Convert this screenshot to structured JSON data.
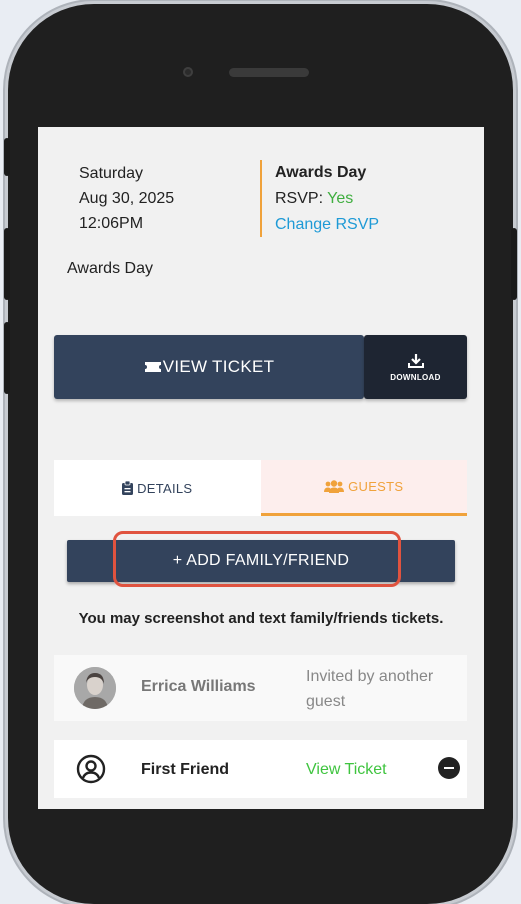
{
  "event": {
    "day": "Saturday",
    "date": "Aug 30, 2025",
    "time": "12:06PM",
    "title": "Awards Day",
    "rsvp_label": "RSVP:",
    "rsvp_value": "Yes",
    "change_rsvp": "Change RSVP",
    "name": "Awards Day"
  },
  "actions": {
    "view_ticket": "VIEW TICKET",
    "download": "DOWNLOAD"
  },
  "tabs": [
    {
      "label": "DETAILS",
      "icon": "clipboard-icon",
      "active": false
    },
    {
      "label": "GUESTS",
      "icon": "users-icon",
      "active": true
    }
  ],
  "guests": {
    "add_button": "+ ADD FAMILY/FRIEND",
    "note": "You may screenshot and text family/friends tickets.",
    "invited_guest": {
      "name": "Errica Williams",
      "status": "Invited by another guest"
    },
    "friend": {
      "name": "First Friend",
      "link": "View Ticket"
    }
  },
  "colors": {
    "primary": "#33435c",
    "accent": "#f0a23b",
    "link": "#1e9ad6",
    "success": "#3fae3f",
    "highlight": "#e0533f"
  }
}
